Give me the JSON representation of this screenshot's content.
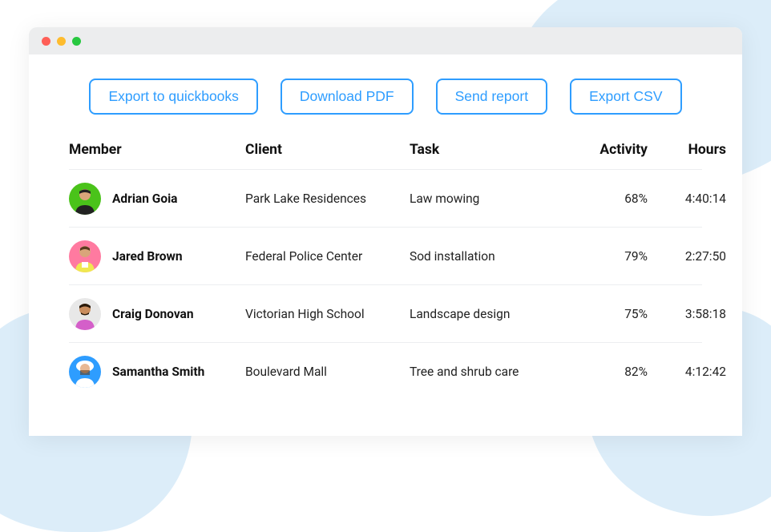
{
  "actions": {
    "export_quickbooks": "Export to quickbooks",
    "download_pdf": "Download PDF",
    "send_report": "Send report",
    "export_csv": "Export CSV"
  },
  "table": {
    "headers": {
      "member": "Member",
      "client": "Client",
      "task": "Task",
      "activity": "Activity",
      "hours": "Hours"
    },
    "rows": [
      {
        "member": "Adrian Goia",
        "avatar_bg": "#4ac31a",
        "client": "Park Lake Residences",
        "task": "Law mowing",
        "activity": "68%",
        "hours": "4:40:14"
      },
      {
        "member": "Jared Brown",
        "avatar_bg": "#ff7aa0",
        "client": "Federal Police Center",
        "task": "Sod installation",
        "activity": "79%",
        "hours": "2:27:50"
      },
      {
        "member": "Craig Donovan",
        "avatar_bg": "#e8e8e8",
        "client": "Victorian High School",
        "task": "Landscape design",
        "activity": "75%",
        "hours": "3:58:18"
      },
      {
        "member": "Samantha Smith",
        "avatar_bg": "#2e9dff",
        "client": "Boulevard Mall",
        "task": "Tree and shrub care",
        "activity": "82%",
        "hours": "4:12:42"
      }
    ]
  }
}
